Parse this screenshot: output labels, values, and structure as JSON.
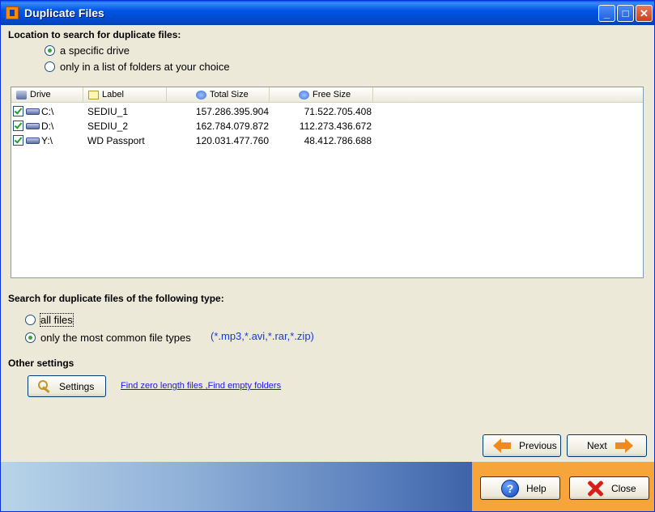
{
  "window": {
    "title": "Duplicate Files"
  },
  "location": {
    "heading": "Location to search for duplicate files:",
    "options": [
      {
        "label": "a specific drive",
        "checked": true
      },
      {
        "label": "only in a list of folders at your choice",
        "checked": false
      }
    ]
  },
  "drives": {
    "columns": [
      "Drive",
      "Label",
      "Total Size",
      "Free Size"
    ],
    "rows": [
      {
        "drive": "C:\\",
        "label": "SEDIU_1",
        "total": "157.286.395.904",
        "free": "71.522.705.408",
        "checked": true
      },
      {
        "drive": "D:\\",
        "label": "SEDIU_2",
        "total": "162.784.079.872",
        "free": "112.273.436.672",
        "checked": true
      },
      {
        "drive": "Y:\\",
        "label": "WD Passport",
        "total": "120.031.477.760",
        "free": "48.412.786.688",
        "checked": true
      }
    ]
  },
  "filetype": {
    "heading": "Search for duplicate files of the following type:",
    "options": [
      {
        "label": "all files",
        "checked": false
      },
      {
        "label": "only the most common file types",
        "checked": true
      }
    ],
    "extensions": "(*.mp3,*.avi,*.rar,*.zip)"
  },
  "other": {
    "heading": "Other settings",
    "settings_label": "Settings",
    "link": "Find zero length files ,Find empty folders"
  },
  "nav": {
    "previous": "Previous",
    "next": "Next"
  },
  "footer": {
    "help": "Help",
    "close": "Close"
  }
}
